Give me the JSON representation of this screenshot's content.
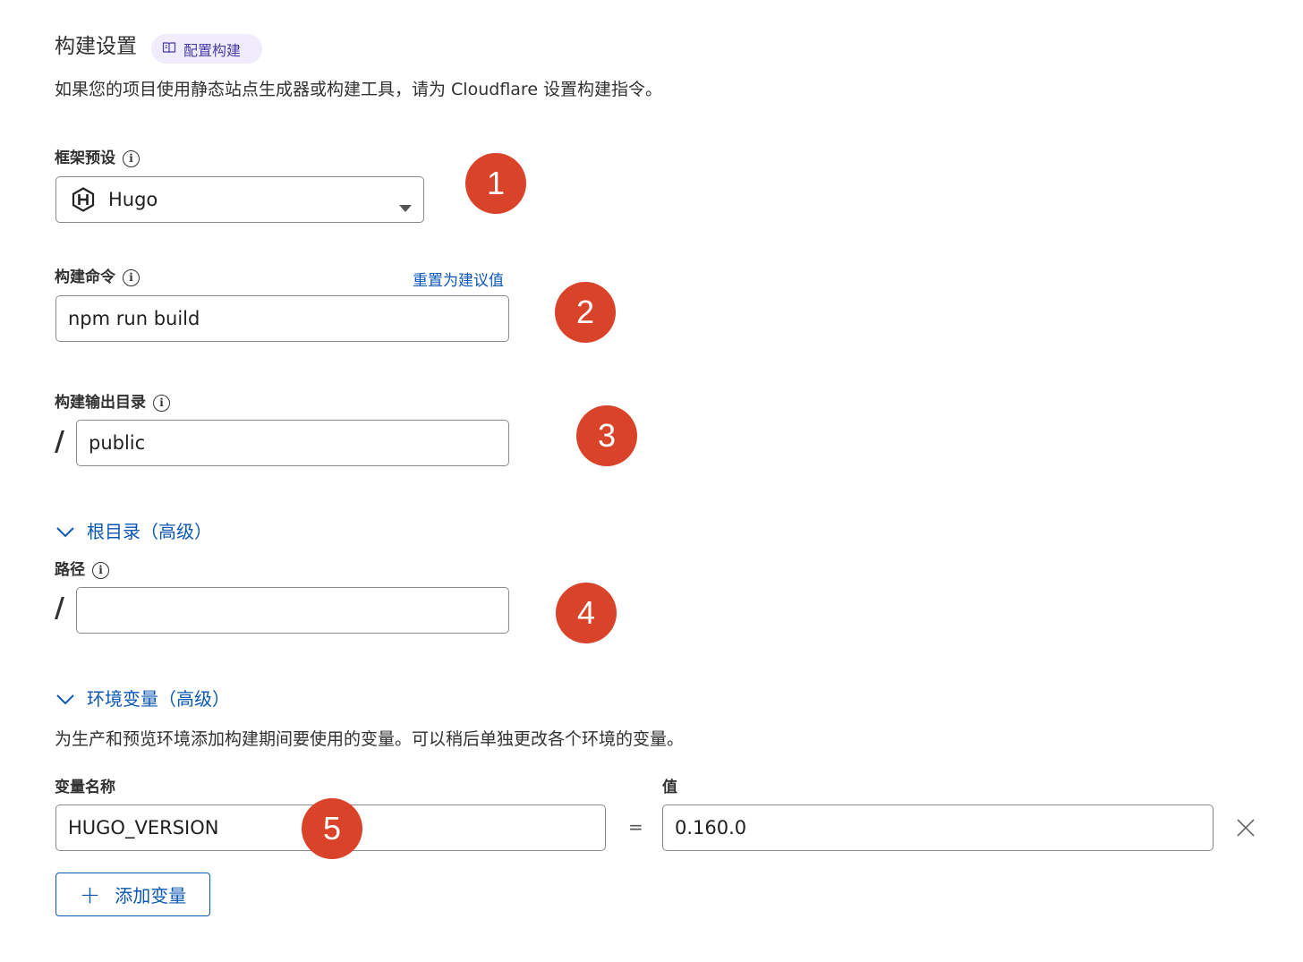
{
  "build_settings": {
    "title": "构建设置",
    "docs_chip_label": "配置构建",
    "description": "如果您的项目使用静态站点生成器或构建工具，请为 Cloudflare 设置构建指令。"
  },
  "framework_preset": {
    "label": "框架预设",
    "selected": "Hugo"
  },
  "build_command": {
    "label": "构建命令",
    "reset_link": "重置为建议值",
    "value": "npm run build"
  },
  "output_dir": {
    "label": "构建输出目录",
    "prefix": "/",
    "value": "public"
  },
  "root_dir": {
    "toggle_label": "根目录（高级）",
    "path_label": "路径",
    "prefix": "/",
    "value": ""
  },
  "env_vars": {
    "toggle_label": "环境变量（高级）",
    "description": "为生产和预览环境添加构建期间要使用的变量。可以稍后单独更改各个环境的变量。",
    "name_header": "变量名称",
    "value_header": "值",
    "equals": "=",
    "rows": [
      {
        "name": "HUGO_VERSION",
        "value": "0.160.0"
      }
    ],
    "add_button_label": "添加变量"
  },
  "markers": [
    "1",
    "2",
    "3",
    "4",
    "5"
  ],
  "colors": {
    "marker": "#d8432a",
    "link": "#0b57b5",
    "chip_bg": "#f0ecfb",
    "chip_text": "#4b3ba8"
  }
}
